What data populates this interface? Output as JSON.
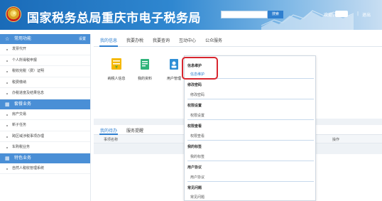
{
  "header": {
    "title": "国家税务总局重庆市电子税务局",
    "search_placeholder": "",
    "search_button": "搜索",
    "welcome": "欢迎，",
    "separator": "|",
    "logout": "退出"
  },
  "sidebar": {
    "sections": [
      {
        "title": "常用功能",
        "action": "设置",
        "items": [
          "发票代开",
          "个人所得税申报",
          "税收完税（费）证明",
          "税费缴纳",
          "办税进度及结果信息"
        ]
      },
      {
        "title": "套餐业务",
        "items": [
          "房产交易",
          "新子任务",
          "跨区域涉税事项办理",
          "车购税业务"
        ]
      },
      {
        "title": "特色业务",
        "items": [
          "自然人税收管理系统"
        ]
      }
    ]
  },
  "main": {
    "tabs": [
      "我的信息",
      "我要办税",
      "我要查询",
      "互动中心",
      "公众服务"
    ],
    "tiles": [
      {
        "label": "纳税人信息",
        "icon": "taxpayer-info-icon"
      },
      {
        "label": "我的资料",
        "icon": "my-documents-icon"
      },
      {
        "label": "用户管理",
        "icon": "user-management-icon"
      }
    ],
    "lower_tabs": [
      "我的待办",
      "服务提醒"
    ],
    "table_headers": [
      "事项名称",
      "操作"
    ]
  },
  "dropdown": {
    "groups": [
      {
        "head": "信息维护",
        "items": [
          "信息维护"
        ]
      },
      {
        "head": "修改密码",
        "items": [
          "修改密码"
        ]
      },
      {
        "head": "权限设置",
        "items": [
          "权限设置"
        ]
      },
      {
        "head": "权限查看",
        "items": [
          "权限查看"
        ]
      },
      {
        "head": "我的标签",
        "items": [
          "我的标签"
        ]
      },
      {
        "head": "用户协议",
        "items": [
          "用户协议"
        ]
      },
      {
        "head": "常见问题",
        "items": [
          "常见问题"
        ]
      }
    ]
  },
  "colors": {
    "accent": "#2f7fcf",
    "sidebar_head": "#4a8fd6",
    "highlight": "#d8262f"
  }
}
